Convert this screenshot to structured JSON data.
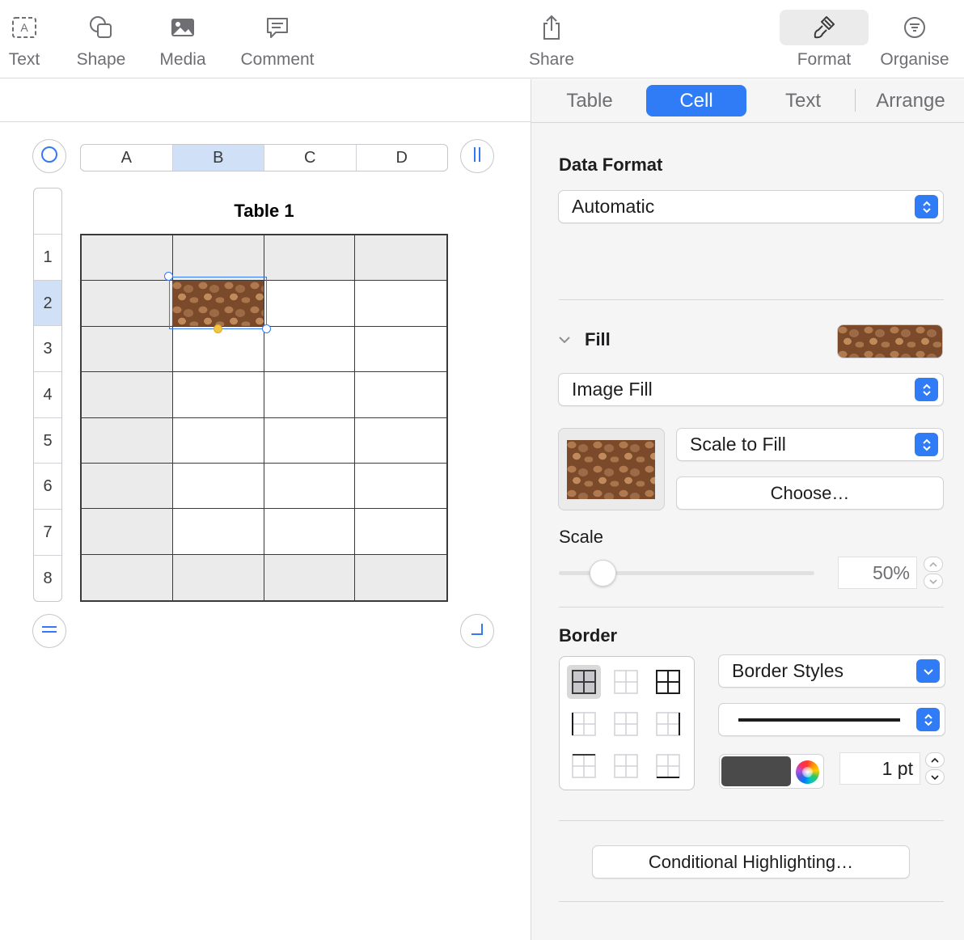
{
  "toolbar": {
    "items": [
      {
        "label": "Text",
        "icon": "text-box-icon"
      },
      {
        "label": "Shape",
        "icon": "shape-icon"
      },
      {
        "label": "Media",
        "icon": "photo-icon"
      },
      {
        "label": "Comment",
        "icon": "comment-icon"
      },
      {
        "label": "Share",
        "icon": "share-icon"
      },
      {
        "label": "Format",
        "icon": "paintbrush-icon",
        "active": true
      },
      {
        "label": "Organise",
        "icon": "organise-icon"
      }
    ]
  },
  "table": {
    "title": "Table 1",
    "columns": [
      "A",
      "B",
      "C",
      "D"
    ],
    "rows": [
      "1",
      "2",
      "3",
      "4",
      "5",
      "6",
      "7",
      "8"
    ],
    "selected_column": "B",
    "selected_row": "2",
    "selected_cell_fill": "stone image"
  },
  "inspector": {
    "tabs": [
      "Table",
      "Cell",
      "Text",
      "Arrange"
    ],
    "active_tab": "Cell",
    "data_format": {
      "title": "Data Format",
      "value": "Automatic"
    },
    "fill": {
      "title": "Fill",
      "type": "Image Fill",
      "scaling": "Scale to Fill",
      "choose_label": "Choose…",
      "scale_label": "Scale",
      "scale_value": "50%",
      "scale_fraction": 0.5
    },
    "border": {
      "title": "Border",
      "styles_label": "Border Styles",
      "width": "1 pt",
      "color": "#4a4a4a"
    },
    "conditional_label": "Conditional Highlighting…"
  },
  "colors": {
    "accent": "#2f7cf6",
    "selection": "#cfe0f7",
    "header_fill": "#ebebeb"
  }
}
